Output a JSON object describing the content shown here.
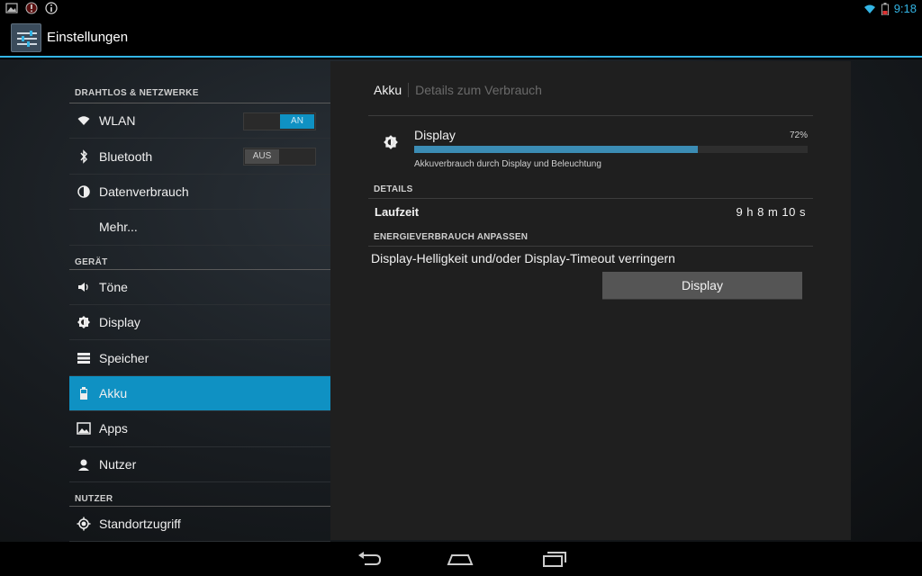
{
  "status_bar": {
    "time": "9:18",
    "left_icons": [
      "gallery-icon",
      "alert-icon",
      "info-icon"
    ],
    "right_icons": [
      "wifi-icon",
      "battery-icon"
    ],
    "accent_color": "#33b5e5"
  },
  "action_bar": {
    "title": "Einstellungen",
    "icon": "settings-sliders-icon"
  },
  "sidebar": {
    "sections": [
      {
        "header": "DRAHTLOS & NETZWERKE",
        "items": [
          {
            "label": "WLAN",
            "icon": "wifi-icon",
            "toggle": "AN",
            "toggle_state": "on"
          },
          {
            "label": "Bluetooth",
            "icon": "bluetooth-icon",
            "toggle": "AUS",
            "toggle_state": "off"
          },
          {
            "label": "Datenverbrauch",
            "icon": "data-usage-icon"
          },
          {
            "label": "Mehr..."
          }
        ]
      },
      {
        "header": "GERÄT",
        "items": [
          {
            "label": "Töne",
            "icon": "speaker-icon"
          },
          {
            "label": "Display",
            "icon": "brightness-icon"
          },
          {
            "label": "Speicher",
            "icon": "storage-icon"
          },
          {
            "label": "Akku",
            "icon": "battery-icon",
            "selected": true
          },
          {
            "label": "Apps",
            "icon": "apps-icon"
          },
          {
            "label": "Nutzer",
            "icon": "user-icon"
          }
        ]
      },
      {
        "header": "NUTZER",
        "items": [
          {
            "label": "Standortzugriff",
            "icon": "location-icon"
          }
        ]
      }
    ],
    "selected_color": "#0f91c3"
  },
  "detail": {
    "breadcrumb": {
      "active": "Akku",
      "inactive": "Details zum Verbrauch"
    },
    "usage": {
      "title": "Display",
      "percent_label": "72%",
      "percent": 72,
      "description": "Akkuverbrauch durch Display und Beleuchtung",
      "icon": "brightness-icon"
    },
    "details_header": "DETAILS",
    "runtime_label": "Laufzeit",
    "runtime_value": "9 h 8 m 10 s",
    "adjust_header": "ENERGIEVERBRAUCH ANPASSEN",
    "advice": "Display-Helligkeit und/oder Display-Timeout verringern",
    "button_label": "Display"
  },
  "navbar": {
    "buttons": [
      "back-icon",
      "home-icon",
      "recents-icon"
    ]
  }
}
